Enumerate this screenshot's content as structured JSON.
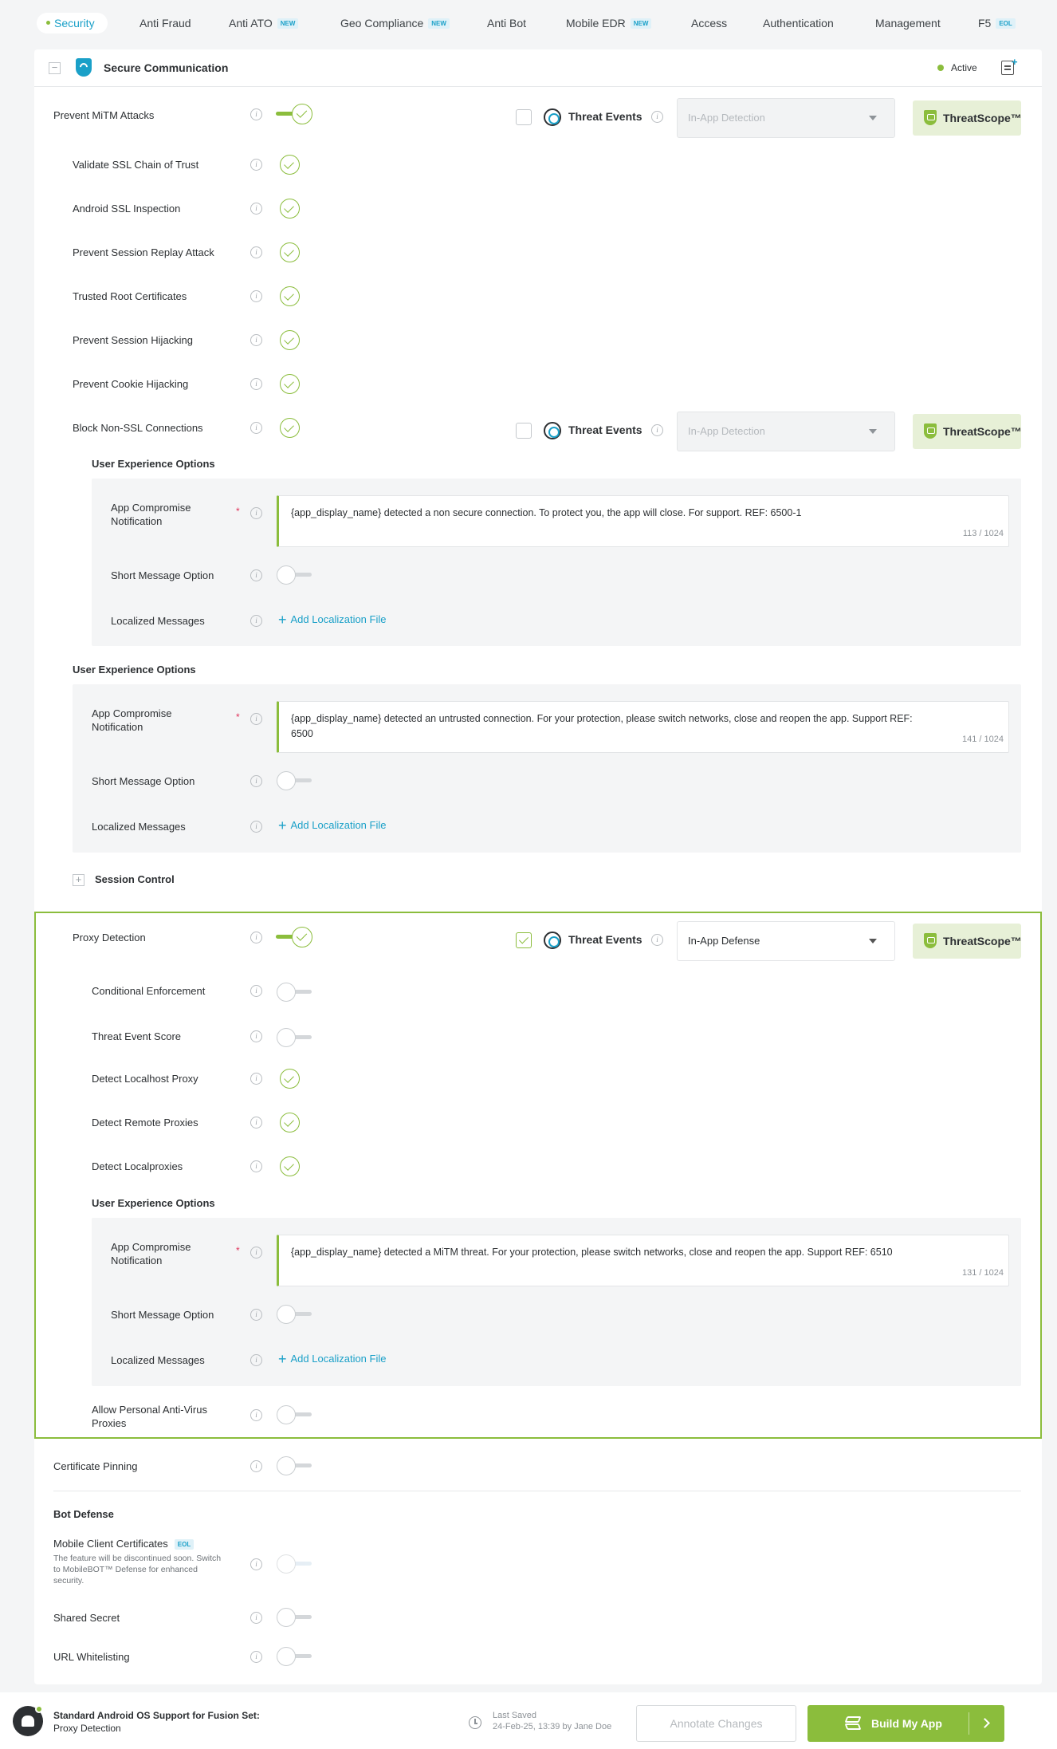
{
  "tabs": [
    {
      "label": "Security",
      "badge": ""
    },
    {
      "label": "Anti Fraud",
      "badge": ""
    },
    {
      "label": "Anti ATO",
      "badge": "NEW"
    },
    {
      "label": "Geo Compliance",
      "badge": "NEW"
    },
    {
      "label": "Anti Bot",
      "badge": ""
    },
    {
      "label": "Mobile EDR",
      "badge": "NEW"
    },
    {
      "label": "Access",
      "badge": ""
    },
    {
      "label": "Authentication",
      "badge": ""
    },
    {
      "label": "Management",
      "badge": ""
    },
    {
      "label": "F5",
      "badge": "EOL"
    }
  ],
  "section": {
    "title": "Secure Communication",
    "status": "Active"
  },
  "threat": {
    "label": "Threat Events",
    "threatscope": "ThreatScope™",
    "disabled_option": "In-App Detection",
    "enabled_option": "In-App Defense"
  },
  "mitm": {
    "label": "Prevent MiTM Attacks",
    "subs": [
      "Validate SSL Chain of Trust",
      "Android SSL Inspection",
      "Prevent Session Replay Attack",
      "Trusted Root Certificates",
      "Prevent Session Hijacking",
      "Prevent Cookie Hijacking",
      "Block Non-SSL Connections"
    ]
  },
  "ux": {
    "title": "User Experience Options",
    "notification_label": "App Compromise Notification",
    "short_label": "Short Message Option",
    "localized_label": "Localized Messages",
    "add_link": "Add Localization File"
  },
  "nonssl_msg": {
    "text": "{app_display_name} detected a non secure connection. To protect you, the app will close. For support. REF: 6500-1",
    "count": "113 / 1024"
  },
  "mitm_msg": {
    "text": "{app_display_name} detected an untrusted connection. For your protection, please switch networks, close and reopen the app. Support REF: 6500",
    "count": "141 / 1024"
  },
  "session_control": "Session Control",
  "proxy": {
    "label": "Proxy Detection",
    "subs": [
      "Conditional Enforcement",
      "Threat Event Score",
      "Detect Localhost Proxy",
      "Detect Remote Proxies",
      "Detect Localproxies"
    ],
    "msg": "{app_display_name} detected a MiTM threat. For your protection, please switch networks, close and reopen the app. Support REF: 6510",
    "count": "131 / 1024",
    "allow_av": "Allow Personal Anti-Virus Proxies"
  },
  "cert_pinning": "Certificate Pinning",
  "bot": {
    "title": "Bot Defense",
    "mcc": "Mobile Client Certificates",
    "mcc_badge": "EOL",
    "mcc_note": "The feature will be discontinued soon. Switch to MobileBOT™ Defense for enhanced security.",
    "shared_secret": "Shared Secret",
    "url_whitelisting": "URL Whitelisting"
  },
  "footer": {
    "app_title": "Standard Android OS Support for Fusion Set:",
    "app_sub": "Proxy Detection",
    "last_saved_label": "Last Saved",
    "last_saved_value": "24-Feb-25, 13:39 by Jane Doe",
    "annotate": "Annotate Changes",
    "build": "Build My App"
  },
  "colors": {
    "accent": "#8bbd3c",
    "link": "#1aa0c8"
  }
}
